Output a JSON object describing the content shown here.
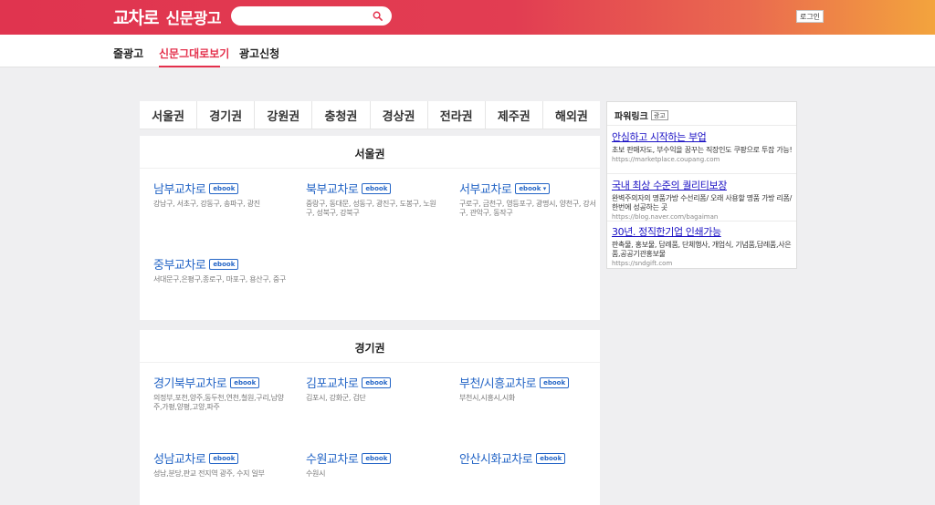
{
  "header": {
    "logo_main": "교차로",
    "logo_sub": "신문광고",
    "search_placeholder": "",
    "login_label": "로그인"
  },
  "nav": {
    "items": [
      {
        "label": "줄광고"
      },
      {
        "label": "신문그대로보기",
        "active": true
      },
      {
        "label": "광고신청"
      }
    ]
  },
  "regions": [
    "서울권",
    "경기권",
    "강원권",
    "충청권",
    "경상권",
    "전라권",
    "제주권",
    "해외권"
  ],
  "sections": [
    {
      "title": "서울권",
      "papers": [
        {
          "name": "남부교차로",
          "badge": "ebook",
          "areas": "강남구, 서초구, 강동구, 송파구, 광진"
        },
        {
          "name": "북부교차로",
          "badge": "ebook",
          "areas": "중랑구, 동대문, 성동구, 광진구, 도봉구, 노원구, 성북구, 강북구"
        },
        {
          "name": "서부교차로",
          "badge": "ebook ▾",
          "areas": "구로구, 금천구, 영등포구, 광명시, 양천구, 강서구, 관악구, 동작구"
        },
        {
          "name": "중부교차로",
          "badge": "ebook",
          "areas": "서대문구,은평구,종로구, 마포구, 용산구, 중구"
        }
      ]
    },
    {
      "title": "경기권",
      "papers": [
        {
          "name": "경기북부교차로",
          "badge": "ebook",
          "areas": "의정부,포천,양주,동두천,연천,철원,구리,남양주,가평,양평,고양,파주"
        },
        {
          "name": "김포교차로",
          "badge": "ebook",
          "areas": "김포시, 강화군, 검단"
        },
        {
          "name": "부천/시흥교차로",
          "badge": "ebook",
          "areas": "부천시,시흥시,시화"
        },
        {
          "name": "성남교차로",
          "badge": "ebook",
          "areas": "성남,분당,판교 전지역 광주, 수지 일부"
        },
        {
          "name": "수원교차로",
          "badge": "ebook",
          "areas": "수원시"
        },
        {
          "name": "안산시화교차로",
          "badge": "ebook",
          "areas": ""
        }
      ]
    }
  ],
  "power_link": {
    "title": "파워링크",
    "badge": "광고",
    "ads": [
      {
        "title": "안심하고 시작하는 부업",
        "desc": "초보 판매자도, 부수익을 꿈꾸는 직장인도 쿠팡으로 투잡 가능!",
        "url": "https://marketplace.coupang.com"
      },
      {
        "title": "국내 최상 수준의 퀄리티보장",
        "desc": "완벽주의자의 명품가방 수선리폼/ 오래 사용할 명품 가방 리폼/ 한번에 성공하는 곳",
        "url": "https://blog.naver.com/bagaiman"
      },
      {
        "title": "30년. 정직한기업 인쇄가능",
        "desc": "판촉물, 홍보물, 답례품, 단체행사, 개업식, 기념품,답례품,사은품,공공기관홍보물",
        "url": "https://sndgift.com"
      }
    ]
  }
}
